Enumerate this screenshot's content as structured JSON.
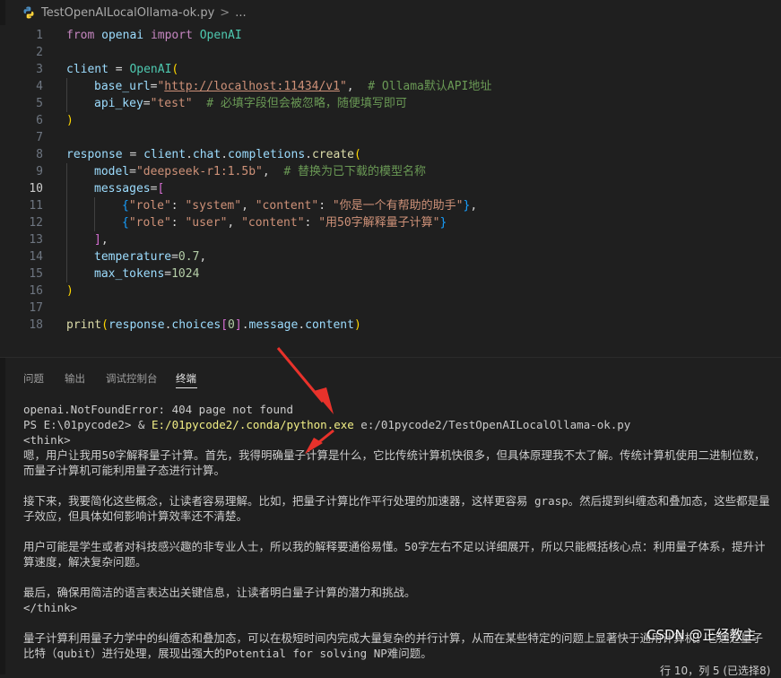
{
  "breadcrumb": {
    "file": "TestOpenAILocalOllama-ok.py",
    "sep": ">",
    "tail": "..."
  },
  "editor": {
    "active_line": 10,
    "lines": [
      {
        "n": "1"
      },
      {
        "n": "2"
      },
      {
        "n": "3"
      },
      {
        "n": "4"
      },
      {
        "n": "5"
      },
      {
        "n": "6"
      },
      {
        "n": "7"
      },
      {
        "n": "8"
      },
      {
        "n": "9"
      },
      {
        "n": "10"
      },
      {
        "n": "11"
      },
      {
        "n": "12"
      },
      {
        "n": "13"
      },
      {
        "n": "14"
      },
      {
        "n": "15"
      },
      {
        "n": "16"
      },
      {
        "n": "17"
      },
      {
        "n": "18"
      }
    ],
    "code": {
      "l1_from": "from",
      "l1_mod": "openai",
      "l1_import": "import",
      "l1_cls": "OpenAI",
      "l3_var": "client",
      "l3_eq": " = ",
      "l3_cls": "OpenAI",
      "l3_paren": "(",
      "l4_kw": "base_url",
      "l4_eq": "=",
      "l4_str_q1": "\"",
      "l4_url": "http://localhost:11434/v1",
      "l4_str_q2": "\"",
      "l4_comma": ",  ",
      "l4_cmt": "# Ollama默认API地址",
      "l5_kw": "api_key",
      "l5_eq": "=",
      "l5_str": "\"test\"",
      "l5_sp": "  ",
      "l5_cmt": "# 必填字段但会被忽略，随便填写即可",
      "l6_paren": ")",
      "l8_var": "response",
      "l8_eq": " = ",
      "l8_obj": "client",
      "l8_dot1": ".",
      "l8_chat": "chat",
      "l8_dot2": ".",
      "l8_comp": "completions",
      "l8_dot3": ".",
      "l8_fn": "create",
      "l8_paren": "(",
      "l9_kw": "model",
      "l9_eq": "=",
      "l9_str": "\"deepseek-r1:1.5b\"",
      "l9_comma": ",  ",
      "l9_cmt": "# 替换为已下载的模型名称",
      "l10_kw": "messages",
      "l10_eq": "=",
      "l10_br": "[",
      "l11_open": "{",
      "l11_k1": "\"role\"",
      "l11_c1": ": ",
      "l11_v1": "\"system\"",
      "l11_s1": ", ",
      "l11_k2": "\"content\"",
      "l11_c2": ": ",
      "l11_v2": "\"你是一个有帮助的助手\"",
      "l11_close": "}",
      "l11_comma": ",",
      "l12_open": "{",
      "l12_k1": "\"role\"",
      "l12_c1": ": ",
      "l12_v1": "\"user\"",
      "l12_s1": ", ",
      "l12_k2": "\"content\"",
      "l12_c2": ": ",
      "l12_v2": "\"用50字解释量子计算\"",
      "l12_close": "}",
      "l13_br": "]",
      "l13_comma": ",",
      "l14_kw": "temperature",
      "l14_eq": "=",
      "l14_num": "0.7",
      "l14_comma": ",",
      "l15_kw": "max_tokens",
      "l15_eq": "=",
      "l15_num": "1024",
      "l16_paren": ")",
      "l18_fn": "print",
      "l18_p1": "(",
      "l18_obj": "response",
      "l18_dot1": ".",
      "l18_choices": "choices",
      "l18_b1": "[",
      "l18_idx": "0",
      "l18_b2": "]",
      "l18_dot2": ".",
      "l18_msg": "message",
      "l18_dot3": ".",
      "l18_content": "content",
      "l18_p2": ")"
    }
  },
  "panel": {
    "tabs": [
      {
        "label": "问题"
      },
      {
        "label": "输出"
      },
      {
        "label": "调试控制台"
      },
      {
        "label": "终端"
      }
    ]
  },
  "terminal": {
    "error": "openai.NotFoundError: 404 page not found",
    "prompt": "PS E:\\01pycode2> & ",
    "cmd_exe": "E:/01pycode2/.conda/python.exe",
    "cmd_arg": " e:/01pycode2/TestOpenAILocalOllama-ok.py",
    "think_open": "<think>",
    "p1": "嗯，用户让我用50字解释量子计算。首先，我得明确量子计算是什么，它比传统计算机快很多，但具体原理我不太了解。传统计算机使用二进制位数，而量子计算机可能利用量子态进行计算。",
    "p2": "接下来，我要简化这些概念，让读者容易理解。比如，把量子计算比作平行处理的加速器，这样更容易 grasp。然后提到纠缠态和叠加态，这些都是量子效应，但具体如何影响计算效率还不清楚。",
    "p3": "用户可能是学生或者对科技感兴趣的非专业人士，所以我的解释要通俗易懂。50字左右不足以详细展开，所以只能概括核心点：利用量子体系，提升计算速度，解决复杂问题。",
    "p4": "最后，确保用简洁的语言表达出关键信息，让读者明白量子计算的潜力和挑战。",
    "think_close": "</think>",
    "answer": "量子计算利用量子力学中的纠缠态和叠加态，可以在极短时间内完成大量复杂的并行计算，从而在某些特定的问题上显著快于通用计算机。它通过量子比特（qubit）进行处理，展现出强大的Potential for solving NP难问题。"
  },
  "status": {
    "text": "行 10，列 5 (已选择8)"
  },
  "watermark": {
    "text": "CSDN @正经教主"
  },
  "colors": {
    "background": "#1f1f1f",
    "arrow": "#e8322b"
  }
}
